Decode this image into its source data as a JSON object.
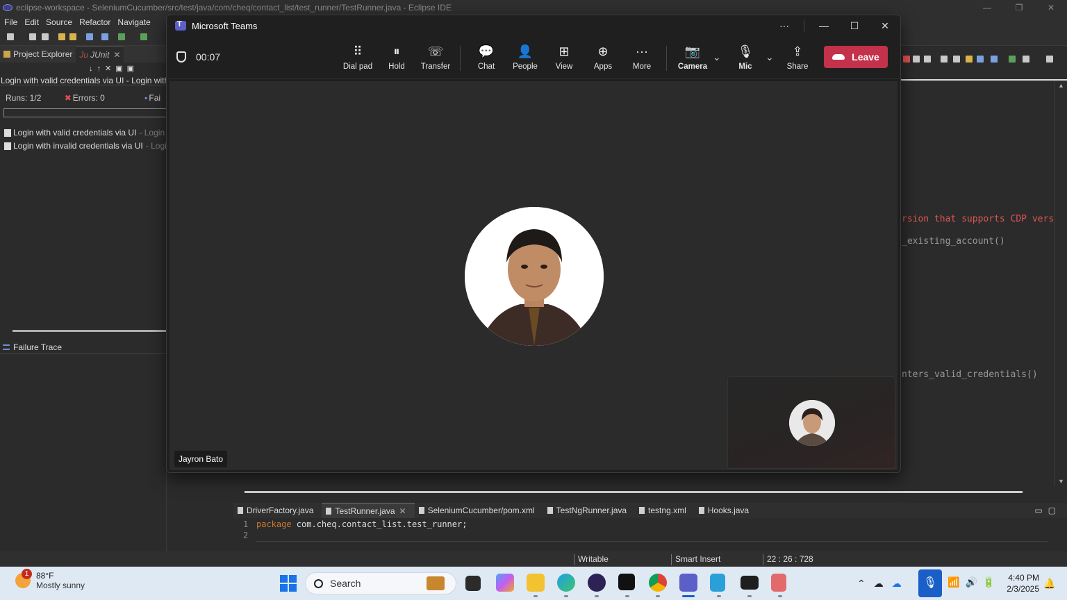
{
  "eclipse": {
    "window_title": "eclipse-workspace - SeleniumCucumber/src/test/java/com/cheq/contact_list/test_runner/TestRunner.java - Eclipse IDE",
    "menu": [
      "File",
      "Edit",
      "Source",
      "Refactor",
      "Navigate"
    ],
    "left_tabs": {
      "project_explorer": "Project Explorer",
      "junit": "JUnit"
    },
    "junit_status": "Login with valid credentials via UI - Login with",
    "runs": "Runs:  1/2",
    "errors": "Errors:  0",
    "failures": "Fai",
    "tests": [
      {
        "name": "Login with valid credentials via UI",
        "sub": "- Login"
      },
      {
        "name": "Login with invalid credentials via UI",
        "sub": "- Logi"
      }
    ],
    "failure_trace": "Failure Trace",
    "code_fragments": {
      "line_a": "rsion that supports CDP version",
      "line_b": "_existing_account()",
      "line_c": "nters_valid_credentials()"
    },
    "editor_tabs": [
      {
        "label": "DriverFactory.java",
        "active": false
      },
      {
        "label": "TestRunner.java",
        "active": true
      },
      {
        "label": "SeleniumCucumber/pom.xml",
        "active": false
      },
      {
        "label": "TestNgRunner.java",
        "active": false
      },
      {
        "label": "testng.xml",
        "active": false
      },
      {
        "label": "Hooks.java",
        "active": false
      }
    ],
    "code": {
      "line1_no": "1",
      "line1_kw": "package",
      "line1_rest": " com.cheq.contact_list.test_runner;",
      "line2_no": "2"
    },
    "status": {
      "writable": "Writable",
      "insert_mode": "Smart Insert",
      "position": "22 : 26 : 728"
    }
  },
  "teams": {
    "title": "Microsoft Teams",
    "timer": "00:07",
    "controls": {
      "dialpad": "Dial pad",
      "hold": "Hold",
      "transfer": "Transfer",
      "chat": "Chat",
      "people": "People",
      "view": "View",
      "apps": "Apps",
      "more": "More",
      "camera": "Camera",
      "mic": "Mic",
      "share": "Share",
      "leave": "Leave"
    },
    "participant_name": "Jayron Bato"
  },
  "taskbar": {
    "weather_temp": "88°F",
    "weather_desc": "Mostly sunny",
    "weather_badge": "1",
    "search_placeholder": "Search",
    "time": "4:40 PM",
    "date": "2/3/2025"
  },
  "colors": {
    "leave_red": "#c4314b",
    "teams_purple": "#5b5fc7",
    "taskbar_bg": "#dfe9f3"
  }
}
